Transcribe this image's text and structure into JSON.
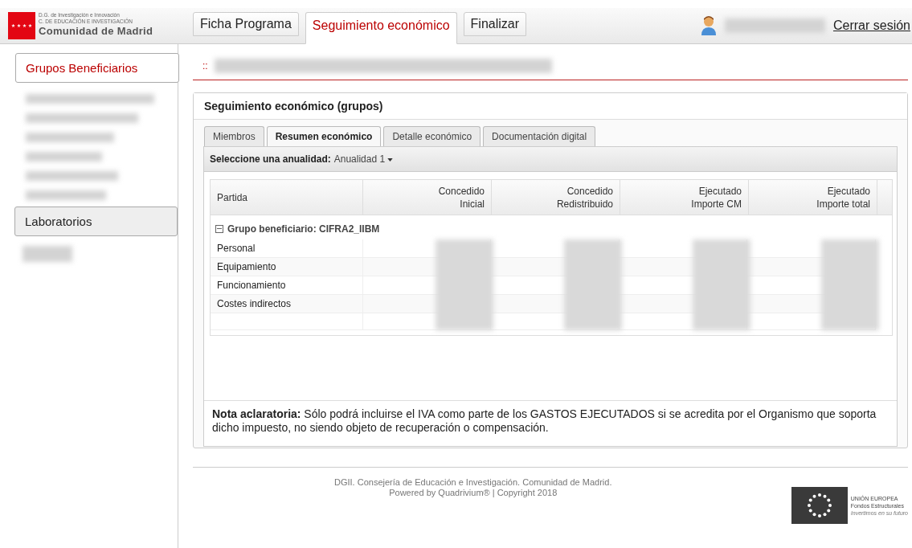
{
  "logo": {
    "lines": [
      "D.G. de Investigación e Innovación",
      "C. DE EDUCACIÓN E INVESTIGACIÓN"
    ],
    "name": "Comunidad de Madrid"
  },
  "top_tabs": [
    {
      "label": "Ficha Programa",
      "selected": false
    },
    {
      "label": "Seguimiento económico",
      "selected": true
    },
    {
      "label": "Finalizar",
      "selected": false
    }
  ],
  "logout": "Cerrar sesión",
  "sidebar": [
    {
      "label": "Grupos Beneficiarios",
      "selected": true
    },
    {
      "label": "Laboratorios",
      "selected": false
    }
  ],
  "breadcrumb": "::",
  "panel": {
    "title": "Seguimiento económico (grupos)",
    "tabs": [
      {
        "label": "Miembros",
        "selected": false
      },
      {
        "label": "Resumen económico",
        "selected": true
      },
      {
        "label": "Detalle económico",
        "selected": false
      },
      {
        "label": "Documentación digital",
        "selected": false
      }
    ],
    "year_label": "Seleccione una anualidad:",
    "year_value": "Anualidad 1",
    "columns": [
      [
        "Partida"
      ],
      [
        "Concedido",
        "Inicial"
      ],
      [
        "Concedido",
        "Redistribuido"
      ],
      [
        "Ejecutado",
        "Importe CM"
      ],
      [
        "Ejecutado",
        "Importe total"
      ]
    ],
    "group": "Grupo beneficiario: CIFRA2_IIBM",
    "rows": [
      "Personal",
      "Equipamiento",
      "Funcionamiento",
      "Costes indirectos"
    ],
    "note_bold": "Nota aclaratoria:",
    "note": "Sólo podrá incluirse el IVA como parte de los GASTOS EJECUTADOS si se acredita por el Organismo que soporta dicho impuesto, no siendo objeto de recuperación o compensación."
  },
  "footer": [
    "DGII. Consejería de Educación e Investigación. Comunidad de Madrid.",
    "Powered by Quadrivium® | Copyright 2018"
  ],
  "eu": [
    "UNIÓN EUROPEA",
    "Fondos Estructurales",
    "Invertimos en su futuro"
  ]
}
